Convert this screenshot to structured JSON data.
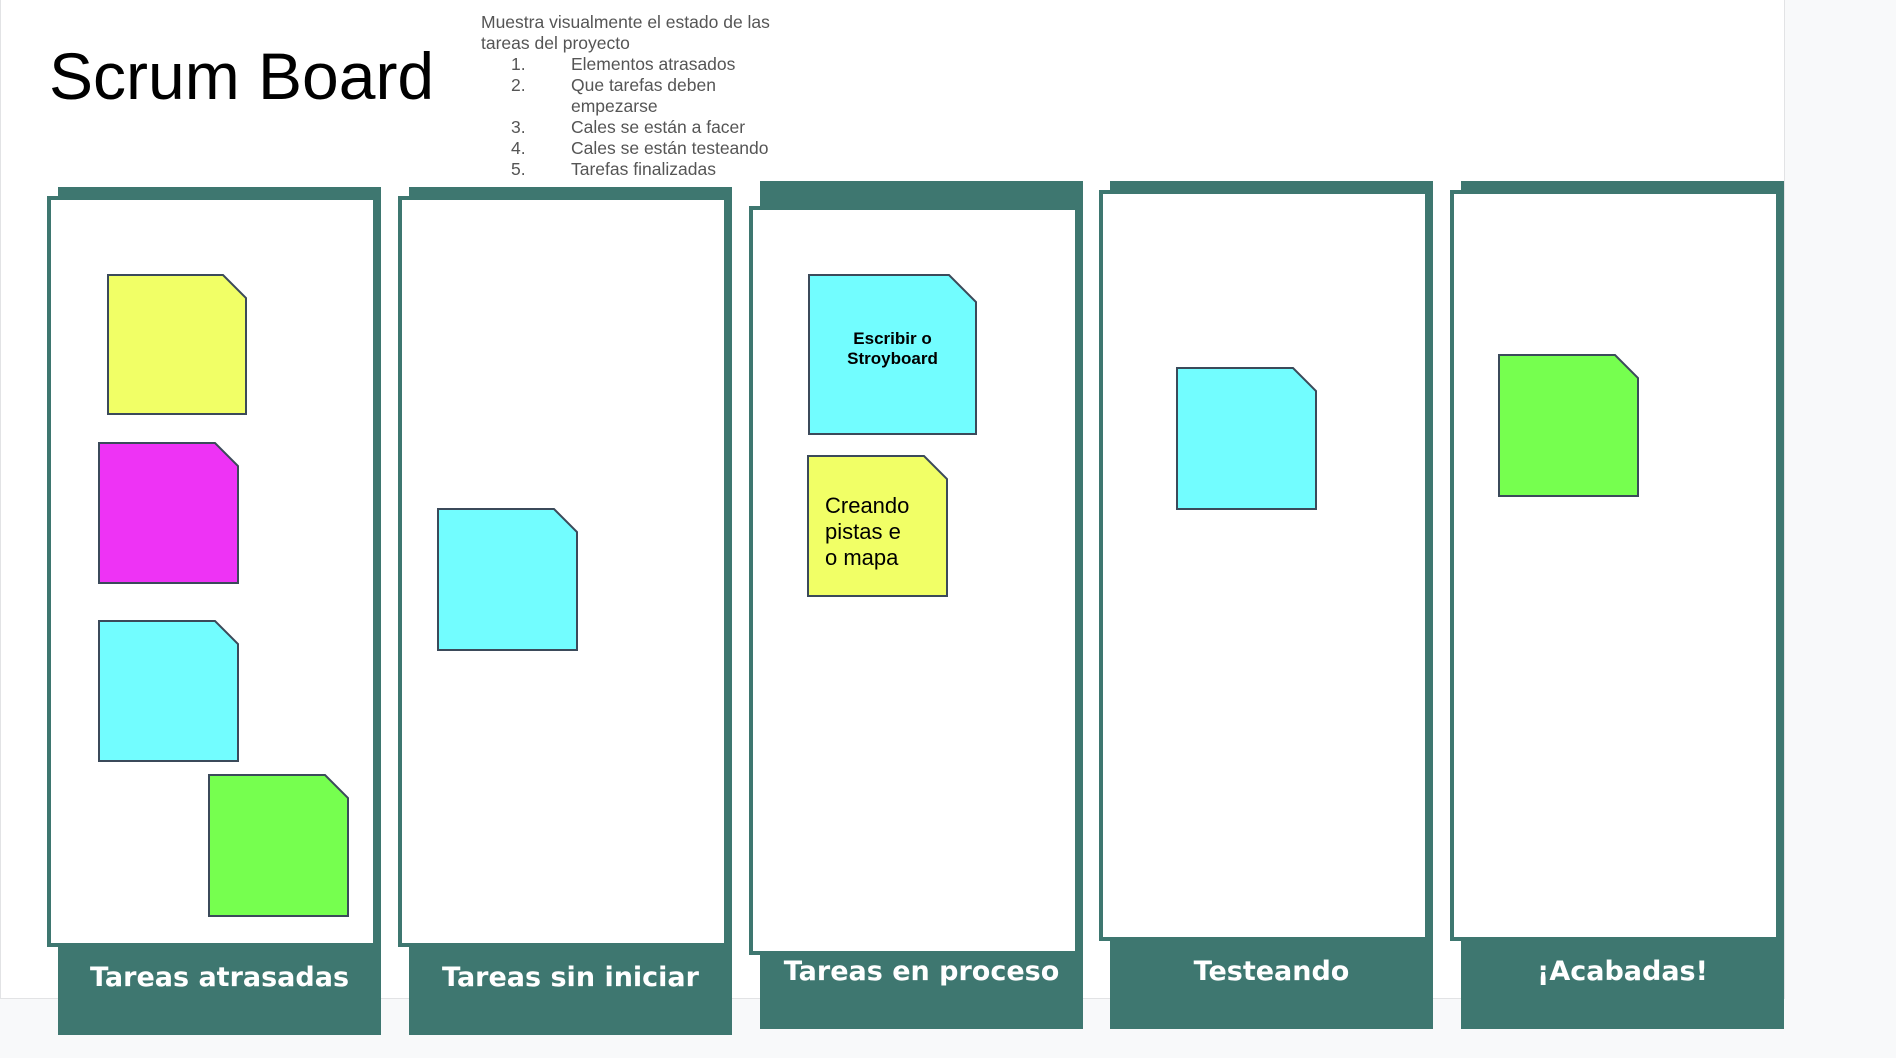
{
  "board": {
    "title": "Scrum Board",
    "description": {
      "intro": "Muestra visualmente el estado de las tareas del proyecto",
      "items": [
        {
          "num": "1.",
          "text": "Elementos atrasados"
        },
        {
          "num": "2.",
          "text": "Que tarefas deben empezarse"
        },
        {
          "num": "3.",
          "text": "Cales se están a facer"
        },
        {
          "num": "4.",
          "text": "Cales se están testeando"
        },
        {
          "num": "5.",
          "text": "Tarefas finalizadas"
        }
      ]
    },
    "columns": [
      {
        "label": "Tareas atrasadas"
      },
      {
        "label": "Tareas sin iniciar"
      },
      {
        "label": "Tareas en proceso"
      },
      {
        "label": "Testeando"
      },
      {
        "label": "¡Acabadas!"
      }
    ],
    "notes": {
      "storyboard": "Escribir o Stroyboard",
      "pistas": "Creando pistas e o mapa"
    }
  },
  "colors": {
    "column": "#3e7770",
    "note_yellow": "#f1ff66",
    "note_magenta": "#ee33f5",
    "note_cyan": "#72fdff",
    "note_green": "#76ff4f",
    "note_border": "#3b4a5a"
  }
}
